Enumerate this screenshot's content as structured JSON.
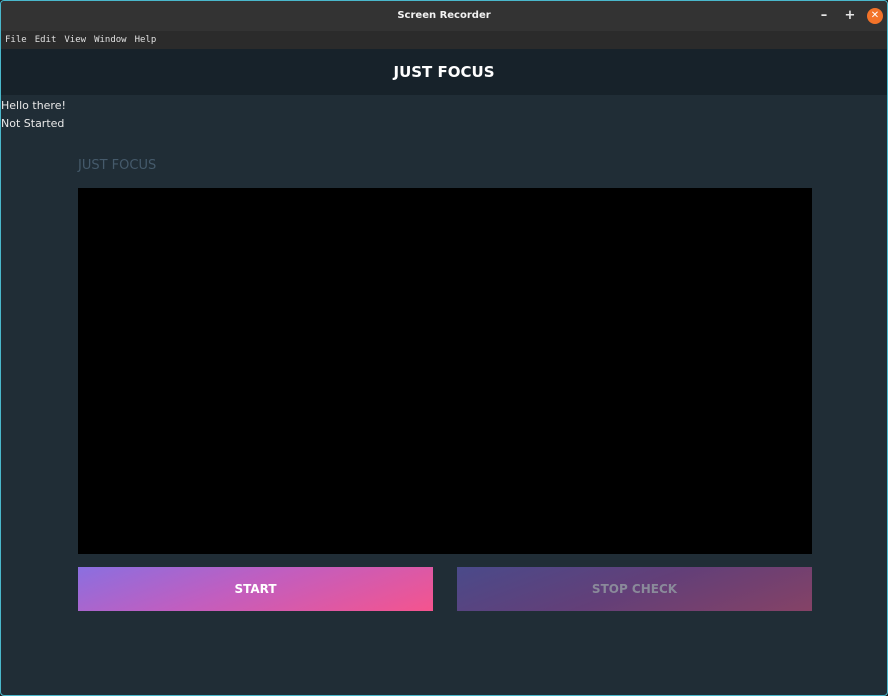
{
  "window": {
    "title": "Screen Recorder",
    "controls": {
      "minimize": "–",
      "maximize": "+",
      "close": "✕"
    }
  },
  "menubar": {
    "items": [
      "File",
      "Edit",
      "View",
      "Window",
      "Help"
    ]
  },
  "app": {
    "header_title": "JUST FOCUS",
    "greeting": "Hello there!",
    "status": "Not Started",
    "section_title": "JUST FOCUS",
    "buttons": {
      "start_label": "START",
      "stop_label": "STOP CHECK"
    }
  },
  "colors": {
    "window_border": "#4ab8cc",
    "background": "#202d36",
    "header_background": "#17222a",
    "close_button": "#f37329",
    "start_gradient_start": "#8a6fe0",
    "start_gradient_end": "#f5548e"
  }
}
